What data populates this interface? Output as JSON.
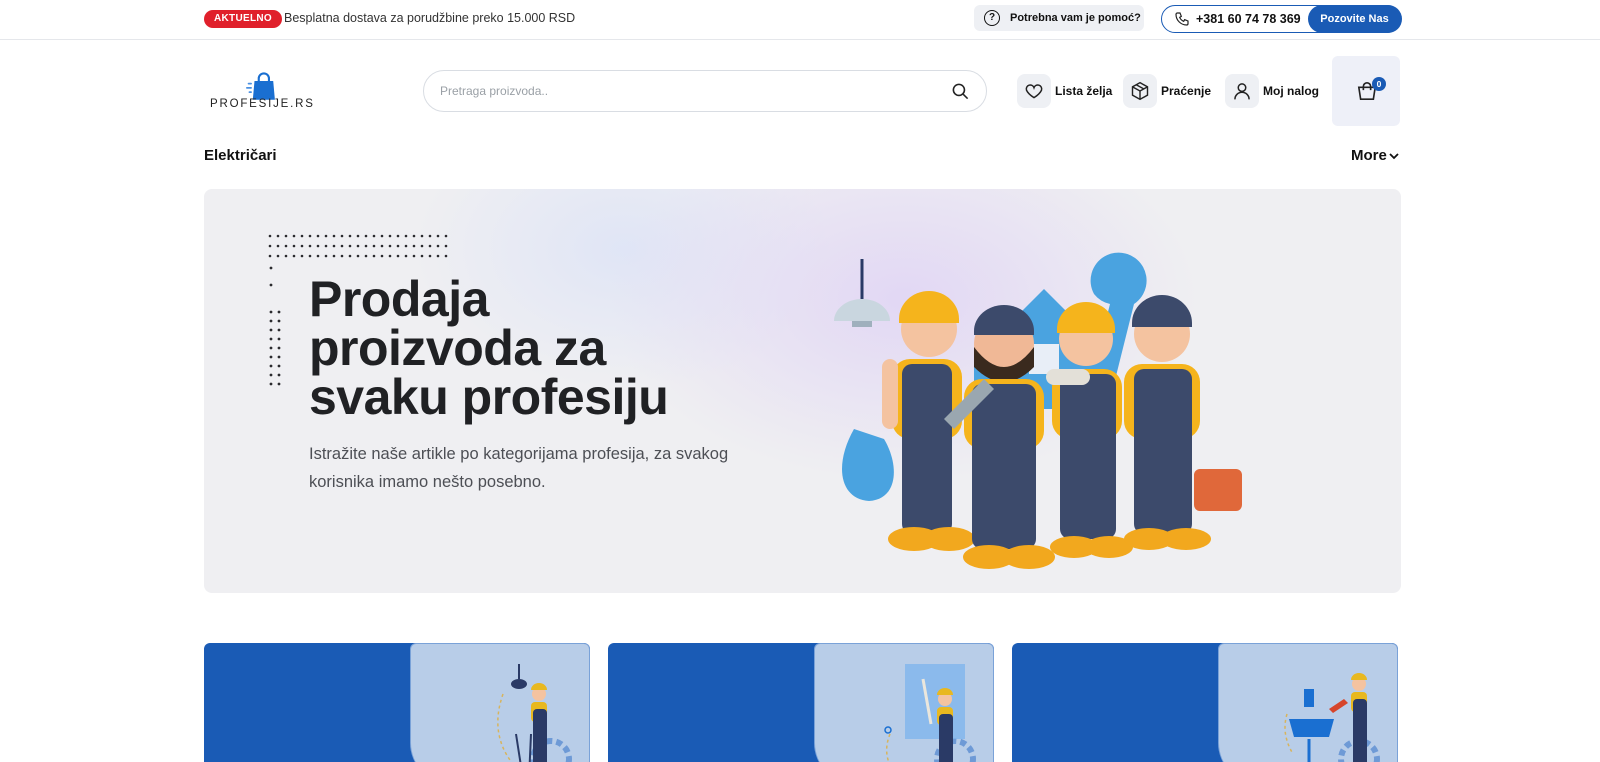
{
  "topbar": {
    "badge": "AKTUELNO",
    "promo": "Besplatna dostava za porudžbine preko 15.000 RSD",
    "help": "Potrebna vam je pomoć?",
    "phone": "+381 60 74 78 369",
    "call_button": "Pozovite Nas"
  },
  "header": {
    "logo_text": "PROFESIJE.RS",
    "search_placeholder": "Pretraga proizvoda..",
    "wishlist": "Lista želja",
    "tracking": "Praćenje",
    "account": "Moj nalog",
    "cart_count": "0"
  },
  "nav": {
    "category": "Električari",
    "more": "More"
  },
  "hero": {
    "title_line1": "Prodaja",
    "title_line2": "proizvoda za",
    "title_line3": "svaku profesiju",
    "subtitle": "Istražite naše artikle po kategorijama profesija, za svakog korisnika imamo nešto posebno."
  },
  "colors": {
    "brand_blue": "#1a5bb5",
    "badge_red": "#e0202b",
    "hero_bg": "#efeff2",
    "card_light": "#b8cde8"
  },
  "icons": [
    "question-icon",
    "phone-icon",
    "search-icon",
    "heart-icon",
    "box-icon",
    "user-icon",
    "cart-icon",
    "chevron-down-icon"
  ]
}
